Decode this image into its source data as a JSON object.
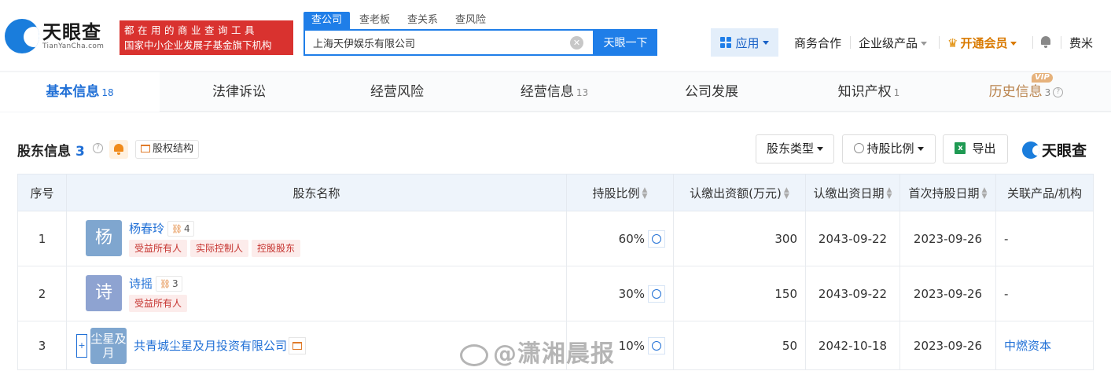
{
  "brand": {
    "name": "天眼查",
    "domain": "TianYanCha.com",
    "slogan_line1": "都在用的商业查询工具",
    "slogan_line2": "国家中小企业发展子基金旗下机构"
  },
  "search": {
    "tabs": [
      "查公司",
      "查老板",
      "查关系",
      "查风险"
    ],
    "value": "上海天伊娱乐有限公司",
    "button": "天眼一下"
  },
  "nav": {
    "app": "应用",
    "business": "商务合作",
    "enterprise": "企业级产品",
    "vip": "开通会员",
    "user": "费米"
  },
  "tabs": [
    {
      "label": "基本信息",
      "count": "18"
    },
    {
      "label": "法律诉讼",
      "count": ""
    },
    {
      "label": "经营风险",
      "count": ""
    },
    {
      "label": "经营信息",
      "count": "13"
    },
    {
      "label": "公司发展",
      "count": ""
    },
    {
      "label": "知识产权",
      "count": "1"
    },
    {
      "label": "历史信息",
      "count": "3"
    }
  ],
  "vip_badge": "VIP",
  "section": {
    "title": "股东信息",
    "count": "3",
    "equity_structure": "股权结构",
    "filter_type": "股东类型",
    "filter_ratio": "持股比例",
    "export": "导出",
    "watermark_logo": "天眼查"
  },
  "table": {
    "headers": [
      "序号",
      "股东名称",
      "持股比例",
      "认缴出资额(万元)",
      "认缴出资日期",
      "首次持股日期",
      "关联产品/机构"
    ],
    "rows": [
      {
        "index": "1",
        "avatar": "杨",
        "avatar_color": "#7fa6cf",
        "name": "杨春玲",
        "rel_count": "4",
        "tags": [
          "受益所有人",
          "实际控制人",
          "控股股东"
        ],
        "ratio": "60%",
        "amount": "300",
        "sub_date": "2043-09-22",
        "first_date": "2023-09-26",
        "related": "-"
      },
      {
        "index": "2",
        "avatar": "诗",
        "avatar_color": "#8ea3d1",
        "name": "诗摇",
        "rel_count": "3",
        "tags": [
          "受益所有人"
        ],
        "ratio": "30%",
        "amount": "150",
        "sub_date": "2043-09-22",
        "first_date": "2023-09-26",
        "related": "-"
      },
      {
        "index": "3",
        "avatar": "尘星及月",
        "avatar_color": "#7fa6cf",
        "name": "共青城尘星及月投资有限公司",
        "expand": "+",
        "ratio": "10%",
        "amount": "50",
        "sub_date": "2042-10-18",
        "first_date": "2023-09-26",
        "related": "中燃资本"
      }
    ]
  },
  "watermark": "@潇湘晨报",
  "colors": {
    "accent": "#1f7ee8",
    "brand_red": "#d9322f",
    "vip": "#d97a00"
  }
}
